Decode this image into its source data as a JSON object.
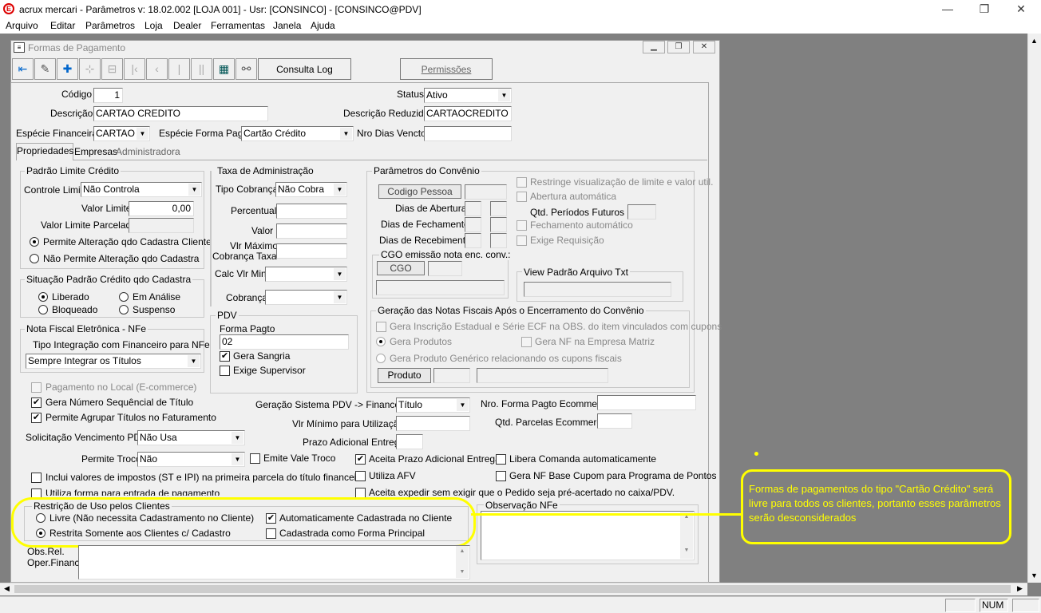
{
  "window": {
    "title": "acrux mercari - Parâmetros  v: 18.02.002  [LOJA 001] - Usr: [CONSINCO] - [CONSINCO@PDV]",
    "minimize": "—",
    "maximize": "❐",
    "close": "✕"
  },
  "menu": [
    "Arquivo",
    "Editar",
    "Parâmetros",
    "Loja",
    "Dealer",
    "Ferramentas",
    "Janela",
    "Ajuda"
  ],
  "form": {
    "title": "Formas de Pagamento",
    "consulta_log": "Consulta Log",
    "permissoes": "Permissões"
  },
  "fields": {
    "codigo_label": "Código",
    "codigo": "1",
    "status_label": "Status",
    "status": "Ativo",
    "descricao_label": "Descrição",
    "descricao": "CARTAO CREDITO",
    "descricao_reduzida_label": "Descrição Reduzida",
    "descricao_reduzida": "CARTAOCREDITO",
    "especie_financeira_label": "Espécie Financeira",
    "especie_financeira": "CARTAO",
    "especie_forma_label": "Espécie Forma Pagto",
    "especie_forma": "Cartão Crédito",
    "nro_dias_label": "Nro Dias Vencto"
  },
  "tabs": [
    "Propriedades",
    "Empresas",
    "Administradora"
  ],
  "padrao_limite": {
    "title": "Padrão Limite Crédito",
    "controle_label": "Controle Limite",
    "controle": "Não Controla",
    "valor_limite_label": "Valor Limite",
    "valor_limite": "0,00",
    "valor_parcelado_label": "Valor Limite Parcelado",
    "opt1": "Permite Alteração qdo Cadastra Cliente",
    "opt2": "Não Permite Alteração qdo Cadastra"
  },
  "situacao": {
    "title": "Situação Padrão Crédito qdo Cadastra",
    "liberado": "Liberado",
    "em_analise": "Em Análise",
    "bloqueado": "Bloqueado",
    "suspenso": "Suspenso"
  },
  "nfe": {
    "title": "Nota Fiscal Eletrônica - NFe",
    "tipo_label": "Tipo Integração com Financeiro para NFe",
    "tipo": "Sempre Integrar os Títulos"
  },
  "taxa": {
    "title": "Taxa de Administração",
    "tipo_label": "Tipo Cobrança",
    "tipo": "Não Cobra",
    "percentual_label": "Percentual",
    "valor_label": "Valor",
    "vlr_max_label1": "Vlr Máximo",
    "vlr_max_label2": "Cobrança Taxa",
    "calc_label": "Calc Vlr Min",
    "cobranca_label": "Cobrança"
  },
  "pdv": {
    "title": "PDV",
    "forma_label": "Forma Pagto",
    "forma": "02",
    "gera_sangria": "Gera Sangria",
    "exige_supervisor": "Exige Supervisor"
  },
  "convenio": {
    "title": "Parâmetros do Convênio",
    "codigo_pessoa": "Codigo Pessoa",
    "dias_abertura": "Dias de Abertura",
    "dias_fechamento": "Dias de Fechamento",
    "dias_recebimento": "Dias de Recebimento",
    "restringe": "Restringe visualização de limite e valor util.",
    "abertura_auto": "Abertura automática",
    "qtd_periodos": "Qtd. Períodos Futuros",
    "fechamento_auto": "Fechamento automático",
    "exige_requisicao": "Exige Requisição",
    "cgo_title": "CGO emissão nota enc. conv.:",
    "cgo_btn": "CGO",
    "view_title": "View Padrão Arquivo Txt"
  },
  "geracao": {
    "title": "Geração das Notas Fiscais Após o Encerramento do Convênio",
    "gera_inscricao": "Gera Inscrição Estadual e Série ECF na OBS. do item vinculados com cupons",
    "gera_produtos": "Gera Produtos",
    "gera_nf_matriz": "Gera NF na Empresa Matriz",
    "gera_generico": "Gera Produto Genérico relacionando os cupons fiscais",
    "produto_btn": "Produto"
  },
  "misc": {
    "pagamento_local": "Pagamento no Local (E-commerce)",
    "gera_numero": "Gera Número Sequêncial de Título",
    "permite_agrupar": "Permite Agrupar Títulos no Faturamento",
    "solicitacao_label": "Solicitação Vencimento PDV",
    "solicitacao": "Não Usa",
    "permite_troco_label": "Permite Troco",
    "permite_troco": "Não",
    "emite_vale": "Emite Vale Troco",
    "inclui_valores": "Inclui valores de impostos (ST e IPI) na primeira parcela do título financeiro",
    "utiliza_forma": "Utiliza forma para entrada de pagamento",
    "geracao_sistema_label": "Geração Sistema PDV -> Financeiro",
    "geracao_sistema": "Título",
    "vlr_minimo_label": "Vlr Mínimo para Utilização",
    "prazo_label": "Prazo Adicional Entrega",
    "nro_ecommerce_label": "Nro. Forma Pagto Ecommerce",
    "qtd_parcelas_label": "Qtd. Parcelas Ecommerce",
    "aceita_prazo": "Aceita Prazo Adicional Entrega",
    "libera_comanda": "Libera Comanda automaticamente",
    "utiliza_afv": "Utiliza AFV",
    "gera_nf_base": "Gera NF Base Cupom para Programa de Pontos",
    "aceita_expedir": "Aceita expedir sem exigir que o Pedido seja pré-acertado no caixa/PDV."
  },
  "restricao": {
    "title": "Restrição de Uso pelos Clientes",
    "livre": "Livre (Não necessita Cadastramento no Cliente)",
    "restrita": "Restrita Somente aos Clientes c/ Cadastro",
    "auto_cadastrada": "Automaticamente Cadastrada no Cliente",
    "cadastrada_principal": "Cadastrada como Forma Principal"
  },
  "obs": {
    "obs_nfe": "Observação NFe",
    "obs_rel1": "Obs.Rel.",
    "obs_rel2": "Oper.Financ."
  },
  "callout": "Formas de pagamentos do tipo \"Cartão Crédito\" será livre para todos os clientes, portanto esses parâmetros serão desconsiderados",
  "status_bar": {
    "num": "NUM"
  },
  "colors": {
    "highlight": "#ffff00",
    "mdi_bg": "#808080"
  }
}
